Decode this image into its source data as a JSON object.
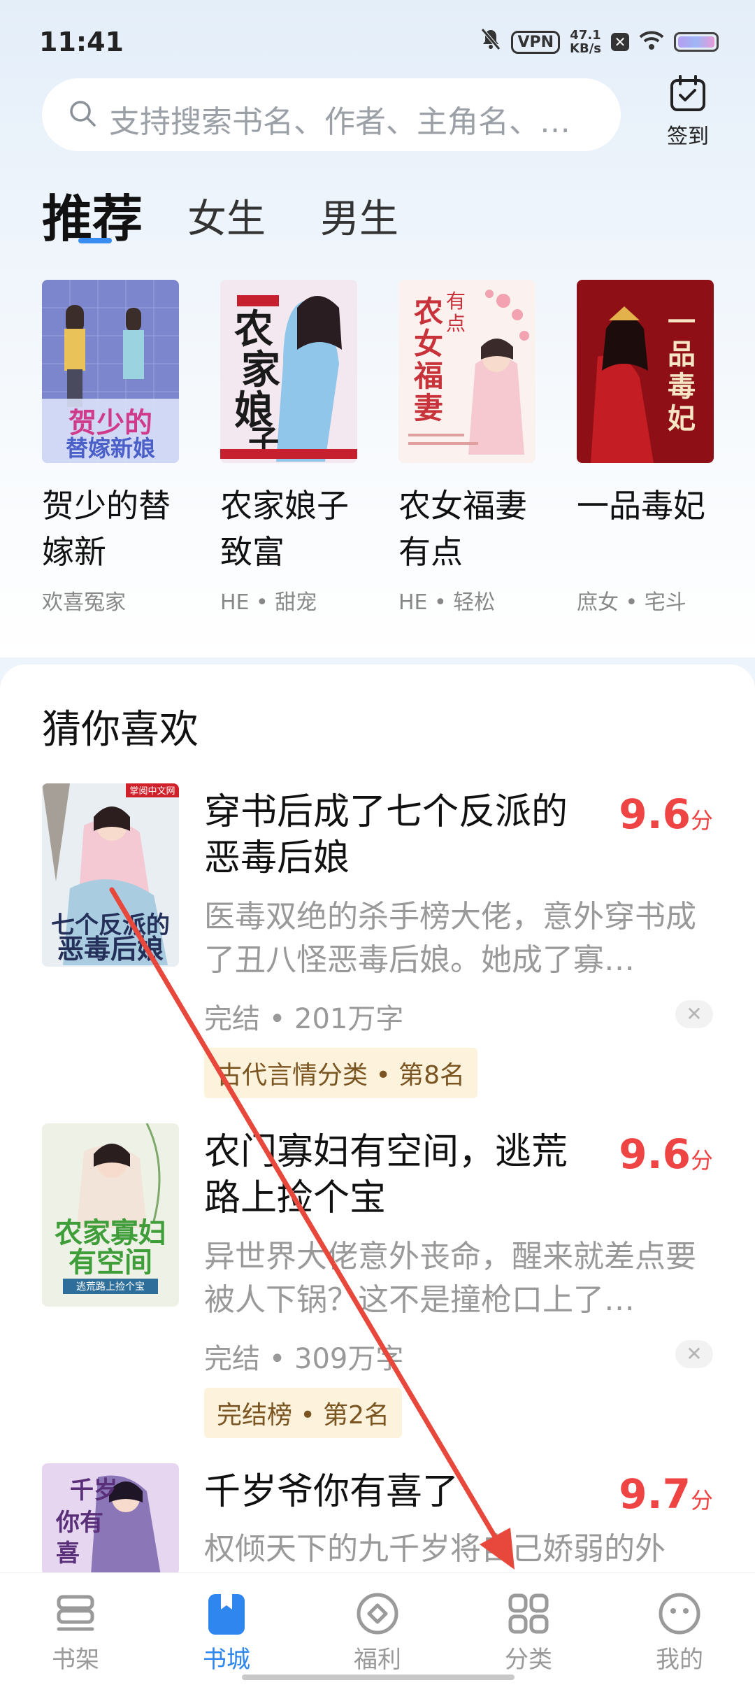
{
  "status_bar": {
    "time": "11:41",
    "vpn": "VPN",
    "speed_value": "47.1",
    "speed_unit": "KB/s"
  },
  "search": {
    "placeholder": "支持搜索书名、作者、主角名、…",
    "checkin_label": "签到"
  },
  "tabs": [
    {
      "label": "推荐",
      "active": true
    },
    {
      "label": "女生",
      "active": false
    },
    {
      "label": "男生",
      "active": false
    }
  ],
  "recommended": [
    {
      "title": "贺少的替嫁新",
      "tags": "欢喜冤家",
      "cover_text": "贺少的替嫁新娘"
    },
    {
      "title": "农家娘子致富",
      "tags": "HE • 甜宠",
      "cover_text": "农家娘子"
    },
    {
      "title": "农女福妻有点",
      "tags": "HE • 轻松",
      "cover_text": "农女有点福妻"
    },
    {
      "title": "一品毒妃",
      "tags": "庶女 • 宅斗",
      "cover_text": "一品毒妃"
    }
  ],
  "guess": {
    "title": "猜你喜欢",
    "items": [
      {
        "title": "穿书后成了七个反派的恶毒后娘",
        "score": "9.6",
        "score_unit": "分",
        "desc": "医毒双绝的杀手榜大佬，意外穿书成了丑八怪恶毒后娘。她成了寡…",
        "meta": "完结 • 201万字",
        "badge": "古代言情分类 • 第8名",
        "dismiss": "✕"
      },
      {
        "title": "农门寡妇有空间，逃荒路上捡个宝",
        "score": "9.6",
        "score_unit": "分",
        "desc": "异世界大佬意外丧命，醒来就差点要被人下锅？这不是撞枪口上了…",
        "meta": "完结 • 309万字",
        "badge": "完结榜 • 第2名",
        "dismiss": "✕"
      },
      {
        "title": "千岁爷你有喜了",
        "score": "9.7",
        "score_unit": "分",
        "desc": "权倾天下的九千岁将自己娇弱的外"
      }
    ]
  },
  "bottom_nav": [
    {
      "label": "书架",
      "icon": "bookshelf-icon",
      "active": false
    },
    {
      "label": "书城",
      "icon": "bookstore-icon",
      "active": true
    },
    {
      "label": "福利",
      "icon": "welfare-icon",
      "active": false
    },
    {
      "label": "分类",
      "icon": "category-icon",
      "active": false
    },
    {
      "label": "我的",
      "icon": "profile-icon",
      "active": false
    }
  ],
  "colors": {
    "accent": "#2f86ee",
    "score": "#ee4444",
    "annotation_arrow": "#e8473b"
  }
}
